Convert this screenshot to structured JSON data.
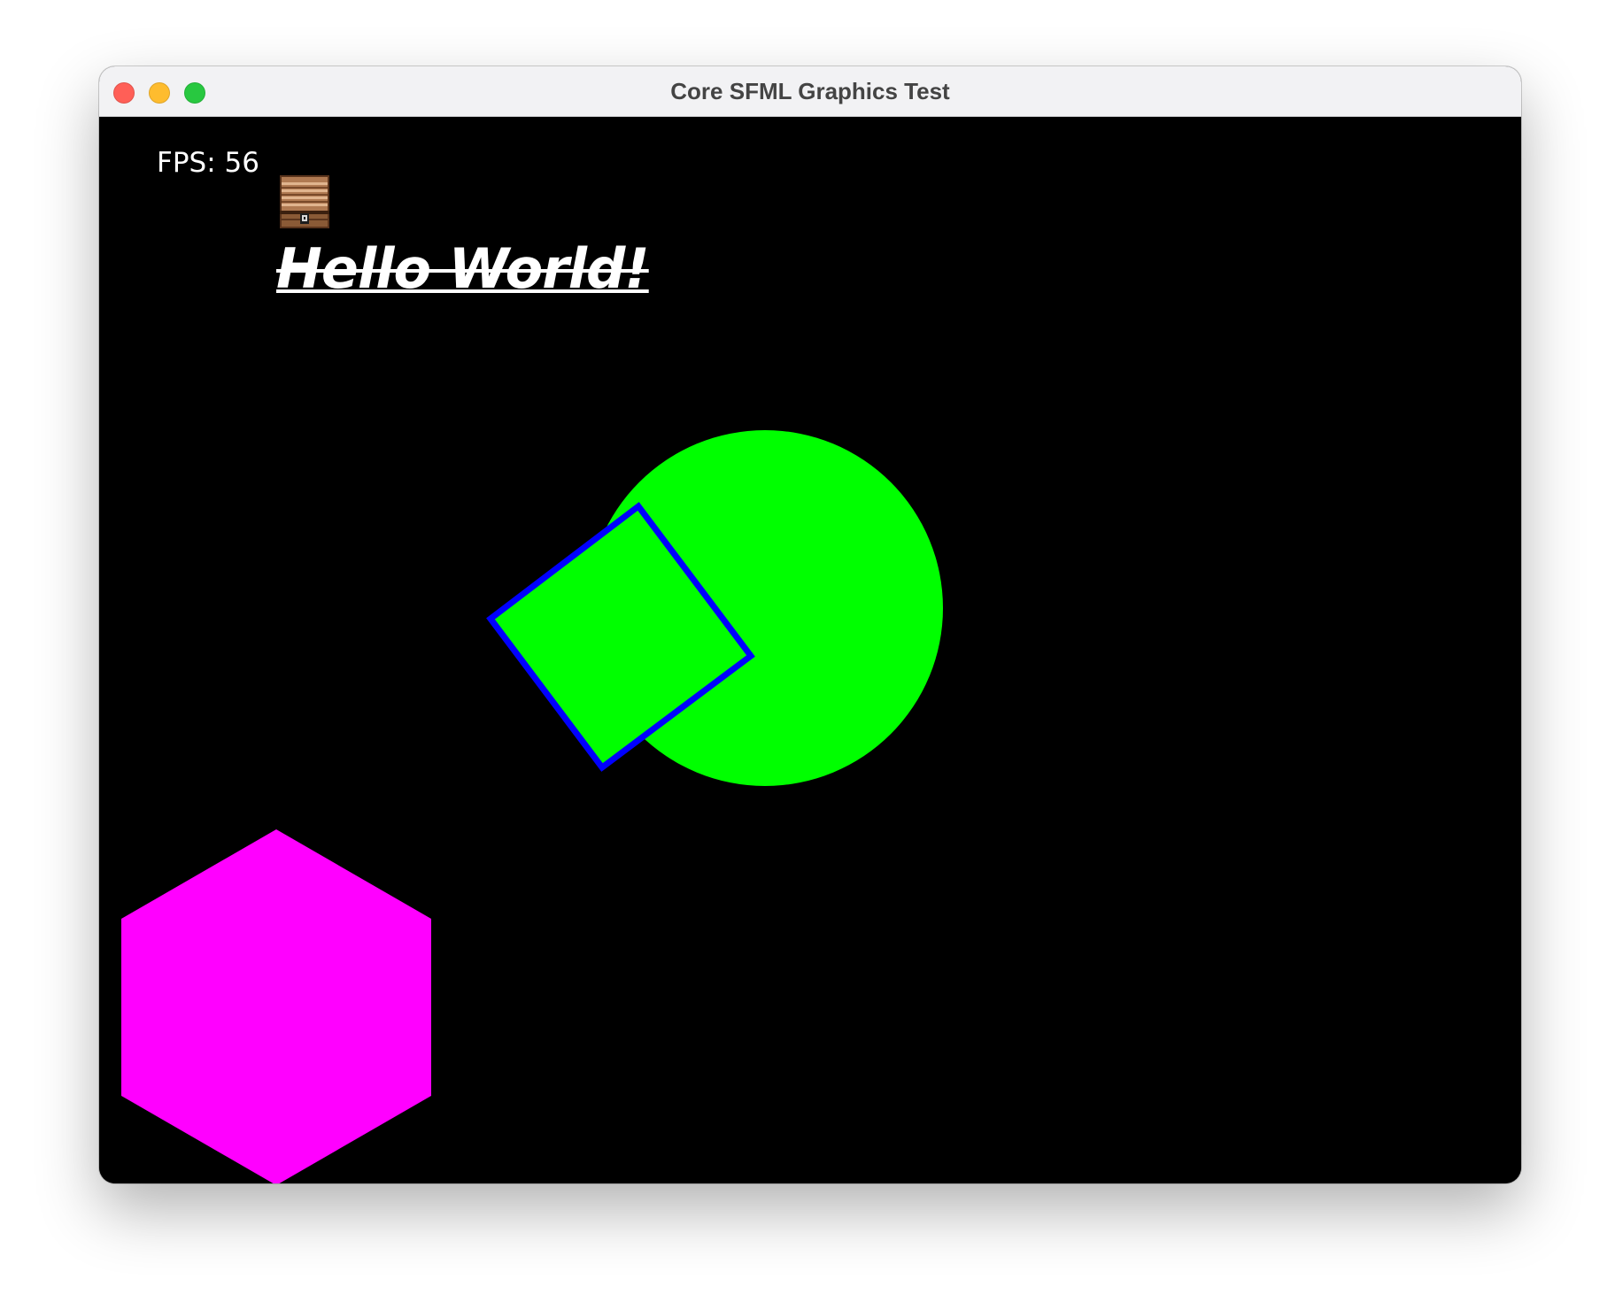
{
  "window": {
    "title": "Core SFML Graphics Test",
    "controls": {
      "close_color": "#ff5f57",
      "minimize_color": "#febc2e",
      "zoom_color": "#28c840"
    }
  },
  "canvas": {
    "background": "#000000",
    "fps_text": "FPS: 56",
    "sprite_icon": "treasure-chest-icon",
    "hello_text": "Hello World!",
    "hello_style": "bold italic, underlined, strikethrough",
    "shapes": {
      "circle": {
        "fill": "#00ff00"
      },
      "rotated_square": {
        "fill": "#00ff00",
        "outline": "#0000ff"
      },
      "hexagon": {
        "fill": "#ff00ff"
      }
    }
  }
}
